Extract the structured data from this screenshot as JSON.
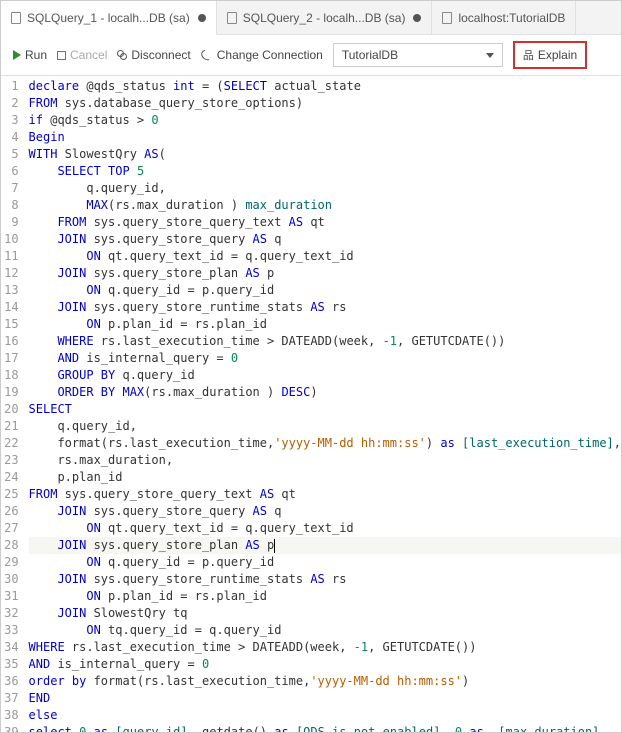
{
  "tabs": [
    {
      "label": "SQLQuery_1 - localh...DB (sa)",
      "dirty": true,
      "active": true
    },
    {
      "label": "SQLQuery_2 - localh...DB (sa)",
      "dirty": true,
      "active": false
    },
    {
      "label": "localhost:TutorialDB",
      "dirty": false,
      "active": false
    }
  ],
  "toolbar": {
    "run": "Run",
    "cancel": "Cancel",
    "disconnect": "Disconnect",
    "change": "Change Connection",
    "db": "TutorialDB",
    "explain": "Explain"
  },
  "code_lines": [
    {
      "n": 1,
      "raw": "declare @qds_status int = (SELECT actual_state",
      "html": "<span class='k'>declare</span> @qds_status <span class='k'>int</span> = (<span class='k'>SELECT</span> actual_state"
    },
    {
      "n": 2,
      "raw": "FROM sys.database_query_store_options)",
      "html": "<span class='k'>FROM</span> sys.database_query_store_options)"
    },
    {
      "n": 3,
      "raw": "if @qds_status > 0",
      "html": "<span class='k'>if</span> @qds_status &gt; <span class='n'>0</span>"
    },
    {
      "n": 4,
      "raw": "Begin",
      "html": "<span class='k'>Begin</span>"
    },
    {
      "n": 5,
      "raw": "WITH SlowestQry AS(",
      "html": "<span class='k'>WITH</span> SlowestQry <span class='k'>AS</span>("
    },
    {
      "n": 6,
      "raw": "    SELECT TOP 5",
      "html": "    <span class='k'>SELECT</span> <span class='k'>TOP</span> <span class='n'>5</span>"
    },
    {
      "n": 7,
      "raw": "        q.query_id,",
      "html": "        q.query_id,"
    },
    {
      "n": 8,
      "raw": "        MAX(rs.max_duration ) max_duration",
      "html": "        <span class='k'>MAX</span>(rs.max_duration ) <span class='fld'>max_duration</span>"
    },
    {
      "n": 9,
      "raw": "    FROM sys.query_store_query_text AS qt",
      "html": "    <span class='k'>FROM</span> sys.query_store_query_text <span class='k'>AS</span> qt"
    },
    {
      "n": 10,
      "raw": "    JOIN sys.query_store_query AS q",
      "html": "    <span class='k'>JOIN</span> sys.query_store_query <span class='k'>AS</span> q"
    },
    {
      "n": 11,
      "raw": "        ON qt.query_text_id = q.query_text_id",
      "html": "        <span class='k'>ON</span> qt.query_text_id = q.query_text_id"
    },
    {
      "n": 12,
      "raw": "    JOIN sys.query_store_plan AS p",
      "html": "    <span class='k'>JOIN</span> sys.query_store_plan <span class='k'>AS</span> p"
    },
    {
      "n": 13,
      "raw": "        ON q.query_id = p.query_id",
      "html": "        <span class='k'>ON</span> q.query_id = p.query_id"
    },
    {
      "n": 14,
      "raw": "    JOIN sys.query_store_runtime_stats AS rs",
      "html": "    <span class='k'>JOIN</span> sys.query_store_runtime_stats <span class='k'>AS</span> rs"
    },
    {
      "n": 15,
      "raw": "        ON p.plan_id = rs.plan_id",
      "html": "        <span class='k'>ON</span> p.plan_id = rs.plan_id"
    },
    {
      "n": 16,
      "raw": "    WHERE rs.last_execution_time > DATEADD(week, -1, GETUTCDATE())",
      "html": "    <span class='k'>WHERE</span> rs.last_execution_time &gt; DATEADD(week, <span class='n'>-1</span>, GETUTCDATE())"
    },
    {
      "n": 17,
      "raw": "    AND is_internal_query = 0",
      "html": "    <span class='k'>AND</span> is_internal_query = <span class='n'>0</span>"
    },
    {
      "n": 18,
      "raw": "    GROUP BY q.query_id",
      "html": "    <span class='k'>GROUP BY</span> q.query_id"
    },
    {
      "n": 19,
      "raw": "    ORDER BY MAX(rs.max_duration ) DESC)",
      "html": "    <span class='k'>ORDER BY</span> <span class='k'>MAX</span>(rs.max_duration ) <span class='k'>DESC</span>)"
    },
    {
      "n": 20,
      "raw": "SELECT",
      "html": "<span class='k'>SELECT</span>"
    },
    {
      "n": 21,
      "raw": "    q.query_id,",
      "html": "    q.query_id,"
    },
    {
      "n": 22,
      "raw": "    format(rs.last_execution_time,'yyyy-MM-dd hh:mm:ss') as [last_execution_time],",
      "html": "    format(rs.last_execution_time,<span class='s'>'yyyy-MM-dd hh:mm:ss'</span>) <span class='k'>as</span> <span class='fld'>[last_execution_time]</span>,"
    },
    {
      "n": 23,
      "raw": "    rs.max_duration,",
      "html": "    rs.max_duration,"
    },
    {
      "n": 24,
      "raw": "    p.plan_id",
      "html": "    p.plan_id"
    },
    {
      "n": 25,
      "raw": "FROM sys.query_store_query_text AS qt",
      "html": "<span class='k'>FROM</span> sys.query_store_query_text <span class='k'>AS</span> qt"
    },
    {
      "n": 26,
      "raw": "    JOIN sys.query_store_query AS q",
      "html": "    <span class='k'>JOIN</span> sys.query_store_query <span class='k'>AS</span> q"
    },
    {
      "n": 27,
      "raw": "        ON qt.query_text_id = q.query_text_id",
      "html": "        <span class='k'>ON</span> qt.query_text_id = q.query_text_id"
    },
    {
      "n": 28,
      "raw": "    JOIN sys.query_store_plan AS p",
      "html": "    <span class='k'>JOIN</span> sys.query_store_plan <span class='k'>AS</span> p<span class='caret-bar'></span>",
      "hl": true
    },
    {
      "n": 29,
      "raw": "        ON q.query_id = p.query_id",
      "html": "        <span class='k'>ON</span> q.query_id = p.query_id"
    },
    {
      "n": 30,
      "raw": "    JOIN sys.query_store_runtime_stats AS rs",
      "html": "    <span class='k'>JOIN</span> sys.query_store_runtime_stats <span class='k'>AS</span> rs"
    },
    {
      "n": 31,
      "raw": "        ON p.plan_id = rs.plan_id",
      "html": "        <span class='k'>ON</span> p.plan_id = rs.plan_id"
    },
    {
      "n": 32,
      "raw": "    JOIN SlowestQry tq",
      "html": "    <span class='k'>JOIN</span> SlowestQry tq"
    },
    {
      "n": 33,
      "raw": "        ON tq.query_id = q.query_id",
      "html": "        <span class='k'>ON</span> tq.query_id = q.query_id"
    },
    {
      "n": 34,
      "raw": "WHERE rs.last_execution_time > DATEADD(week, -1, GETUTCDATE())",
      "html": "<span class='k'>WHERE</span> rs.last_execution_time &gt; DATEADD(week, <span class='n'>-1</span>, GETUTCDATE())"
    },
    {
      "n": 35,
      "raw": "AND is_internal_query = 0",
      "html": "<span class='k'>AND</span> is_internal_query = <span class='n'>0</span>"
    },
    {
      "n": 36,
      "raw": "order by format(rs.last_execution_time,'yyyy-MM-dd hh:mm:ss')",
      "html": "<span class='k'>order by</span> format(rs.last_execution_time,<span class='s'>'yyyy-MM-dd hh:mm:ss'</span>)"
    },
    {
      "n": 37,
      "raw": "END",
      "html": "<span class='k'>END</span>"
    },
    {
      "n": 38,
      "raw": "else",
      "html": "<span class='k'>else</span>"
    },
    {
      "n": 39,
      "raw": "select 0 as [query_id], getdate() as [QDS is not enabled], 0 as  [max_duration]",
      "html": "<span class='k'>select</span> <span class='n'>0</span> <span class='k'>as</span> <span class='fld'>[query_id]</span>, getdate() <span class='k'>as</span> <span class='fld'>[QDS is not enabled]</span>, <span class='n'>0</span> <span class='k'>as</span>  <span class='fld'>[max_duration]</span>"
    }
  ]
}
